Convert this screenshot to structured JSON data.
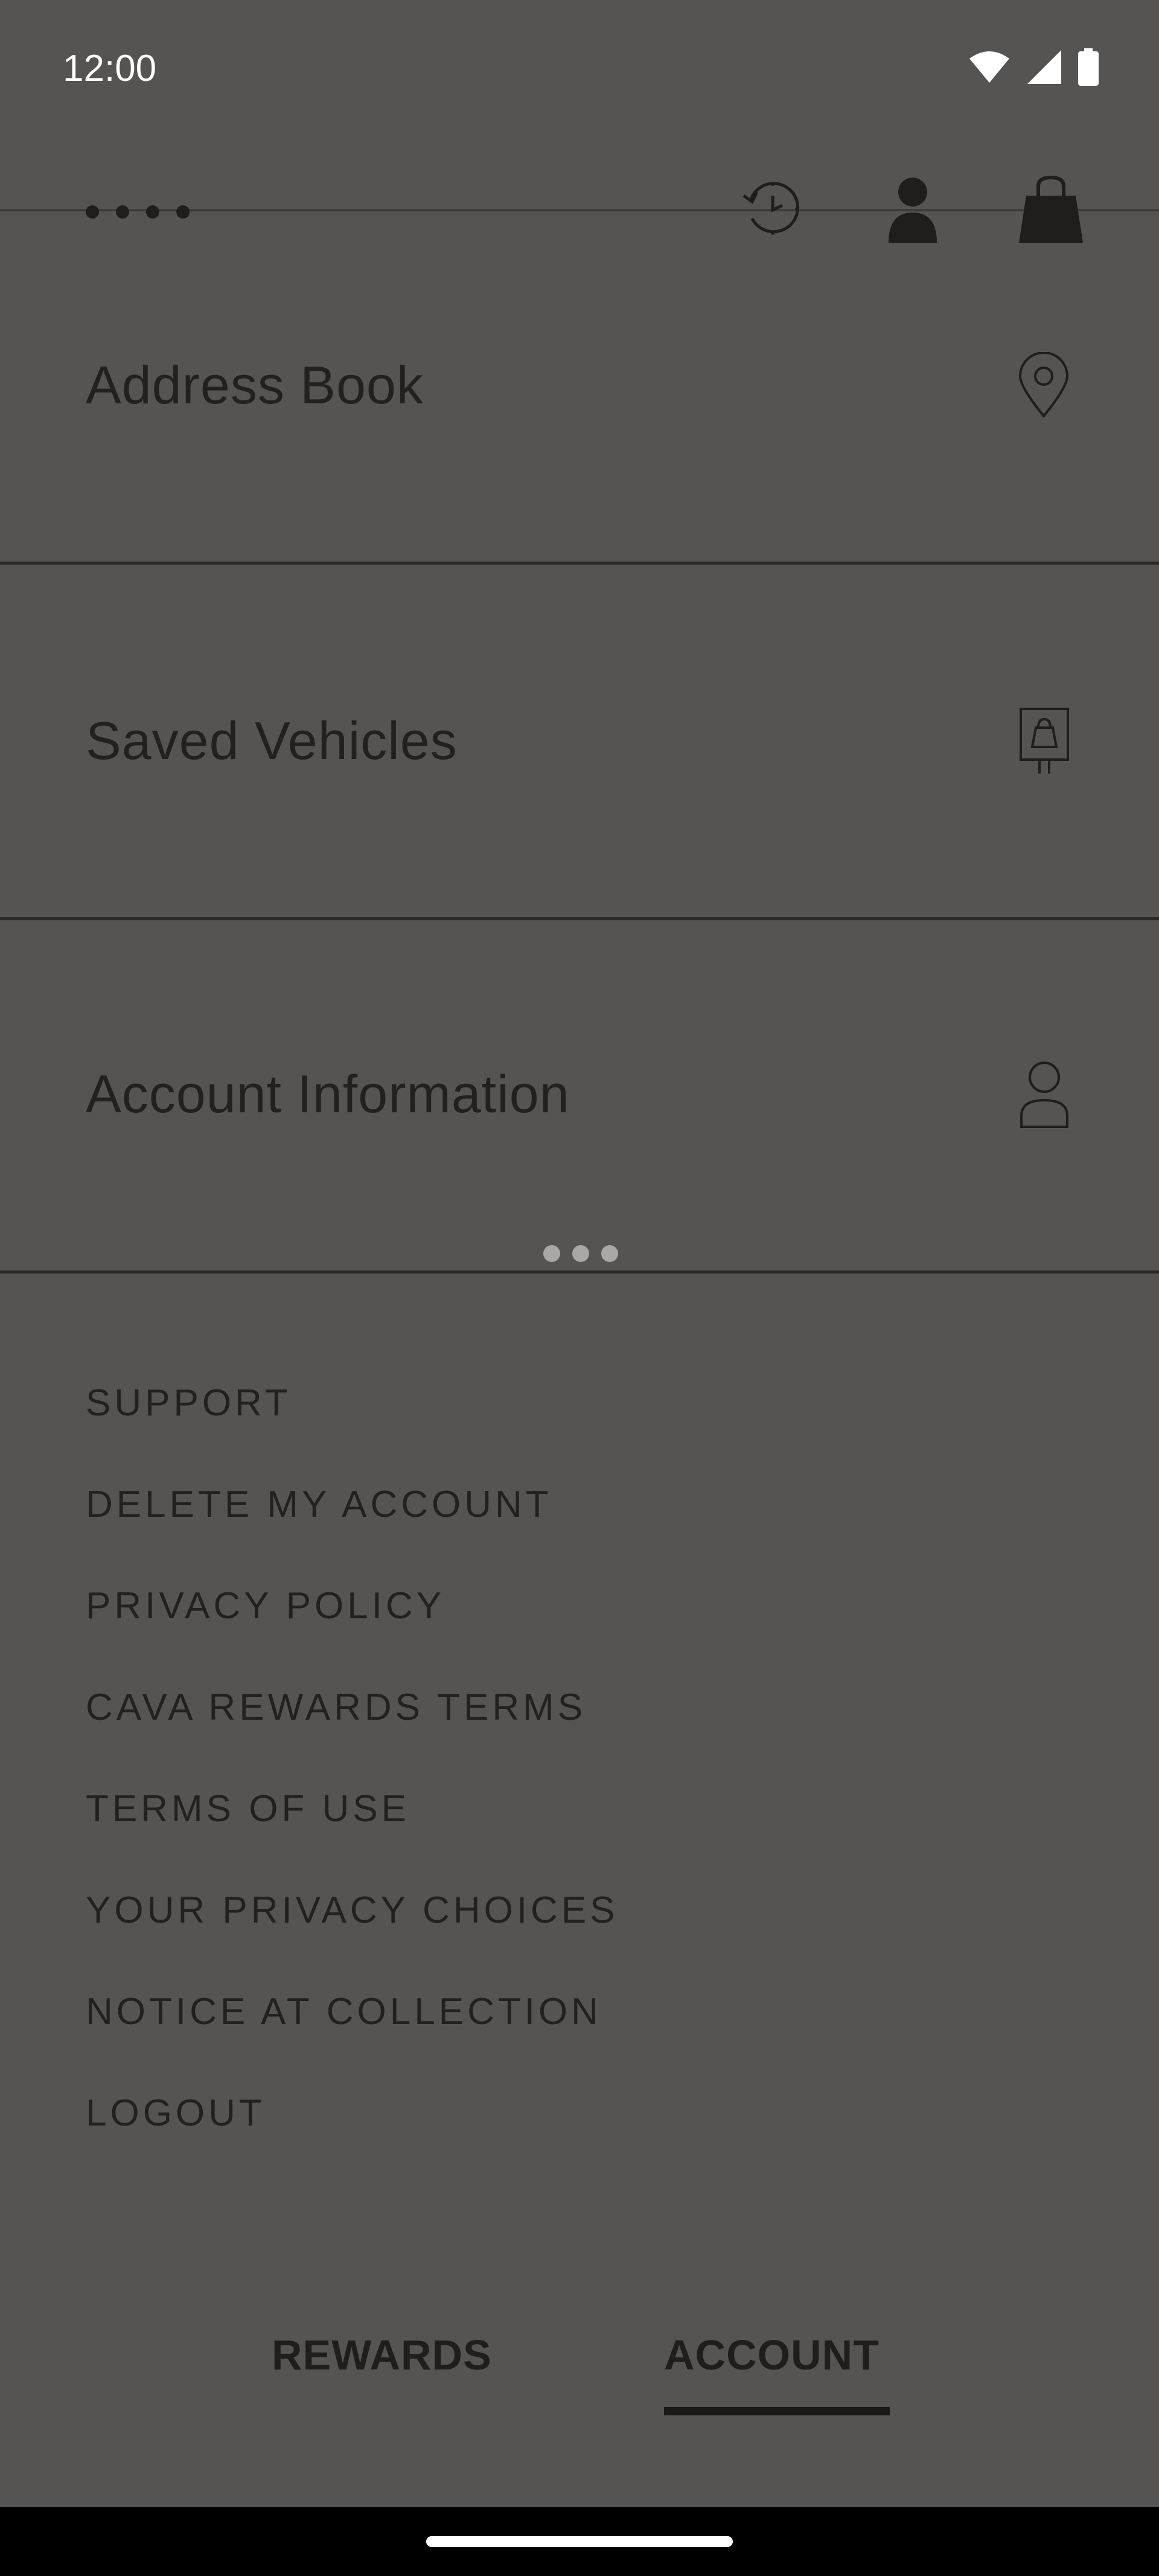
{
  "status_bar": {
    "time": "12:00",
    "icons": [
      "wifi-icon",
      "signal-icon",
      "battery-icon"
    ]
  },
  "header": {
    "logo": "dots-logo",
    "icons": [
      "order-history-icon",
      "account-icon",
      "bag-icon"
    ]
  },
  "menu": {
    "items": [
      {
        "label": "Address Book",
        "icon": "location-pin-icon"
      },
      {
        "label": "Saved Vehicles",
        "icon": "vehicle-sign-icon"
      },
      {
        "label": "Account Information",
        "icon": "person-outline-icon"
      }
    ]
  },
  "links": [
    "SUPPORT",
    "DELETE MY ACCOUNT",
    "PRIVACY POLICY",
    "CAVA REWARDS TERMS",
    "TERMS OF USE",
    "YOUR PRIVACY CHOICES",
    "NOTICE AT COLLECTION",
    "LOGOUT"
  ],
  "tabs": {
    "rewards": "REWARDS",
    "account": "ACCOUNT",
    "active": "account"
  },
  "colors": {
    "background": "#555452",
    "text": "#1f1e1d",
    "nav_bar": "#000000"
  }
}
